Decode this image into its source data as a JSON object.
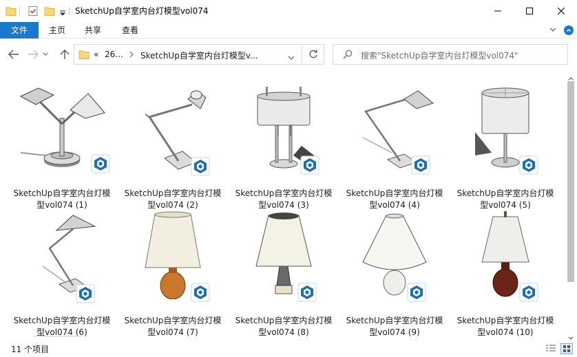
{
  "window": {
    "title": "SketchUp自学室内台灯模型vol074"
  },
  "ribbon": {
    "tabs": [
      "文件",
      "主页",
      "共享",
      "查看"
    ]
  },
  "address": {
    "overflow": "«",
    "crumb1": "26...",
    "crumb2": "SketchUp自学室内台灯模型v..."
  },
  "search": {
    "placeholder": "搜索\"SketchUp自学室内台灯模型vol074\""
  },
  "files": [
    {
      "name": "SketchUp自学室内台灯模型vol074 (1)",
      "icon": "sketchup-file-icon"
    },
    {
      "name": "SketchUp自学室内台灯模型vol074 (2)",
      "icon": "sketchup-file-icon"
    },
    {
      "name": "SketchUp自学室内台灯模型vol074 (3)",
      "icon": "sketchup-file-icon"
    },
    {
      "name": "SketchUp自学室内台灯模型vol074 (4)",
      "icon": "sketchup-file-icon"
    },
    {
      "name": "SketchUp自学室内台灯模型vol074 (5)",
      "icon": "sketchup-file-icon"
    },
    {
      "name": "SketchUp自学室内台灯模型vol074 (6)",
      "icon": "sketchup-file-icon"
    },
    {
      "name": "SketchUp自学室内台灯模型vol074 (7)",
      "icon": "sketchup-file-icon"
    },
    {
      "name": "SketchUp自学室内台灯模型vol074 (8)",
      "icon": "sketchup-file-icon"
    },
    {
      "name": "SketchUp自学室内台灯模型vol074 (9)",
      "icon": "sketchup-file-icon"
    },
    {
      "name": "SketchUp自学室内台灯模型vol074 (10)",
      "icon": "sketchup-file-icon"
    }
  ],
  "status": {
    "count": "11 个项目"
  },
  "colors": {
    "accent": "#1979ca",
    "sketchup_badge": "#1f6fb5",
    "folder": "#f8d775"
  }
}
